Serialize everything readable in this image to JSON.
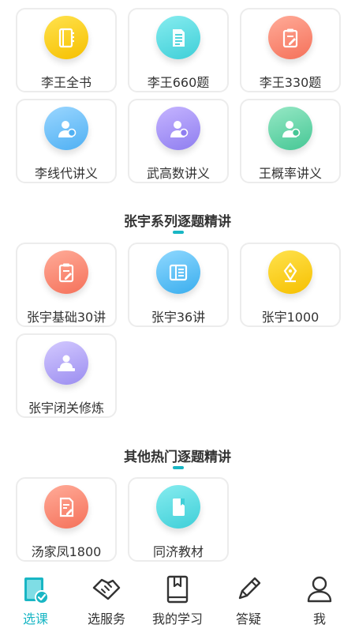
{
  "sections": [
    {
      "title": "",
      "items": [
        {
          "label": "李王全书",
          "icon": "notebook-icon",
          "color": "#f6c000"
        },
        {
          "label": "李王660题",
          "icon": "document-list-icon",
          "color": "#3fcfd8"
        },
        {
          "label": "李王330题",
          "icon": "clipboard-edit-icon",
          "color": "#f5715a"
        },
        {
          "label": "李线代讲义",
          "icon": "teacher-icon",
          "color": "#4fb0f3"
        },
        {
          "label": "武高数讲义",
          "icon": "teacher-icon",
          "color": "#8f7ef0"
        },
        {
          "label": "王概率讲义",
          "icon": "teacher-icon",
          "color": "#46c795"
        }
      ]
    },
    {
      "title": "张宇系列逐题精讲",
      "items": [
        {
          "label": "张宇基础30讲",
          "icon": "clipboard-edit-icon",
          "color": "#f5715a"
        },
        {
          "label": "张宇36讲",
          "icon": "list-card-icon",
          "color": "#3aaeee"
        },
        {
          "label": "张宇1000",
          "icon": "pen-nib-icon",
          "color": "#f6c000"
        },
        {
          "label": "张宇闭关修炼",
          "icon": "presenter-icon",
          "color": "#9b8df0"
        }
      ]
    },
    {
      "title": "其他热门逐题精讲",
      "items": [
        {
          "label": "汤家凤1800",
          "icon": "document-edit-icon",
          "color": "#f5715a"
        },
        {
          "label": "同济教材",
          "icon": "book-icon",
          "color": "#3fcfd8"
        }
      ]
    }
  ],
  "tabbar": {
    "items": [
      {
        "label": "选课",
        "icon": "course-book-icon",
        "active": true
      },
      {
        "label": "选服务",
        "icon": "handshake-icon",
        "active": false
      },
      {
        "label": "我的学习",
        "icon": "bookmark-book-icon",
        "active": false
      },
      {
        "label": "答疑",
        "icon": "pencil-icon",
        "active": false
      },
      {
        "label": "我",
        "icon": "user-icon",
        "active": false
      }
    ],
    "accent_color": "#19b6c4"
  }
}
